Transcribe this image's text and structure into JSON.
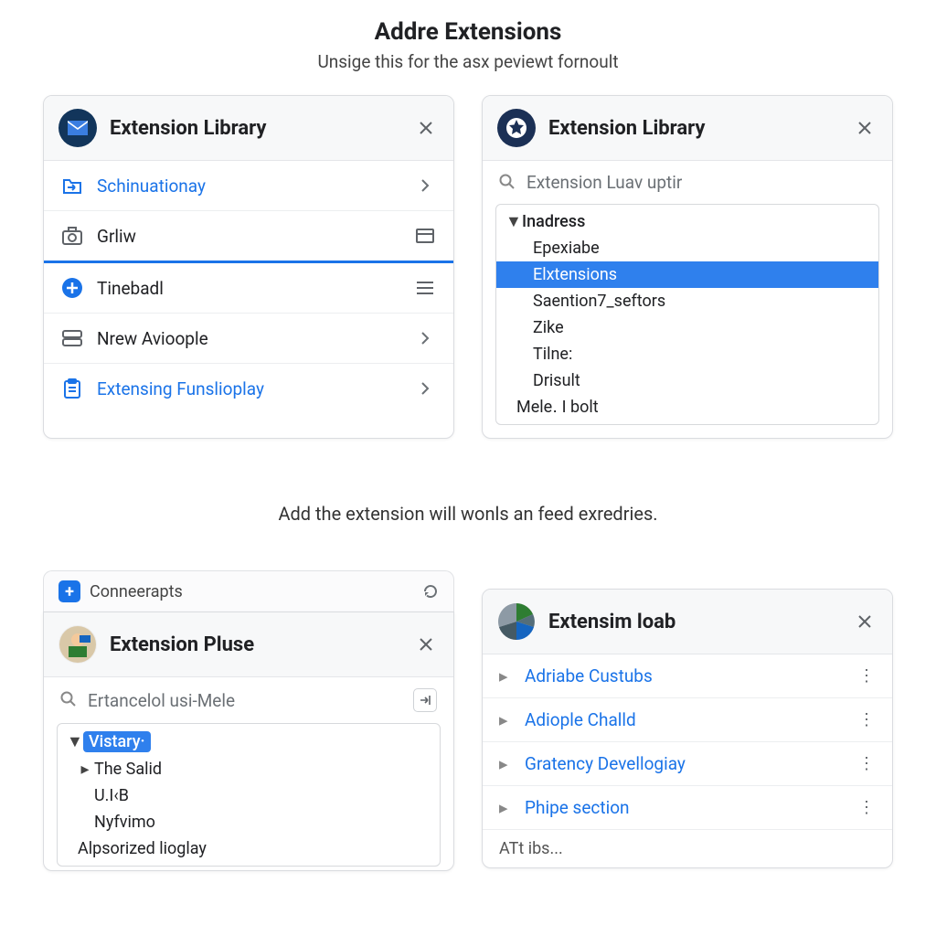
{
  "header": {
    "title": "Addre Extensions",
    "subtitle": "Unsige this for the asx peviewt fornoult"
  },
  "panel1": {
    "title": "Extension Library",
    "rows": [
      {
        "icon": "folder-arrow-icon",
        "label": "Schinuationay",
        "labelColor": "link",
        "right": "chevron"
      },
      {
        "icon": "camera-icon",
        "label": "Grliw",
        "labelColor": "plain",
        "right": "rectangle",
        "activeUnderline": true
      },
      {
        "icon": "plus-circle-icon",
        "label": "Tinebadl",
        "labelColor": "plain",
        "right": "hamburger"
      },
      {
        "icon": "server-icon",
        "label": "Nrew Avioople",
        "labelColor": "plain",
        "right": "chevron"
      },
      {
        "icon": "clipboard-icon",
        "label": "Extensing Funslioplay",
        "labelColor": "link",
        "right": "chevron"
      }
    ]
  },
  "panel2": {
    "title": "Extension Library",
    "searchPlaceholder": "Extension Luav uptir",
    "tree": {
      "root": "Inadress",
      "children": [
        {
          "label": "Epexiabe"
        },
        {
          "label": "Elxtensions",
          "selected": true
        },
        {
          "label": "Saention7_seftors"
        },
        {
          "label": "Zike"
        },
        {
          "label": "Tilne:"
        },
        {
          "label": "Drisult"
        }
      ],
      "siblingAfter": "Mele․ I bolt"
    }
  },
  "midCaption": "Add the extension will wonls an feed exredries.",
  "panel3": {
    "stripLabel": "Conneerapts",
    "title": "Extension Pluse",
    "searchPlaceholder": "Ertancelol usi-Mele",
    "tree": {
      "root": "Vistary·",
      "rootBadge": true,
      "children": [
        {
          "label": "The Salid",
          "hasCaret": true
        },
        {
          "label": "U.I‹B"
        },
        {
          "label": "Nyfvimo"
        }
      ],
      "siblingAfter": "Alpsorized lioglay"
    }
  },
  "panel4": {
    "title": "Extensim loab",
    "rows": [
      {
        "label": "Adriabe Custubs"
      },
      {
        "label": "Adiople Challd"
      },
      {
        "label": "Gratency Devellogiay"
      },
      {
        "label": "Phipe section"
      }
    ],
    "footer": "ATt ibs..."
  }
}
